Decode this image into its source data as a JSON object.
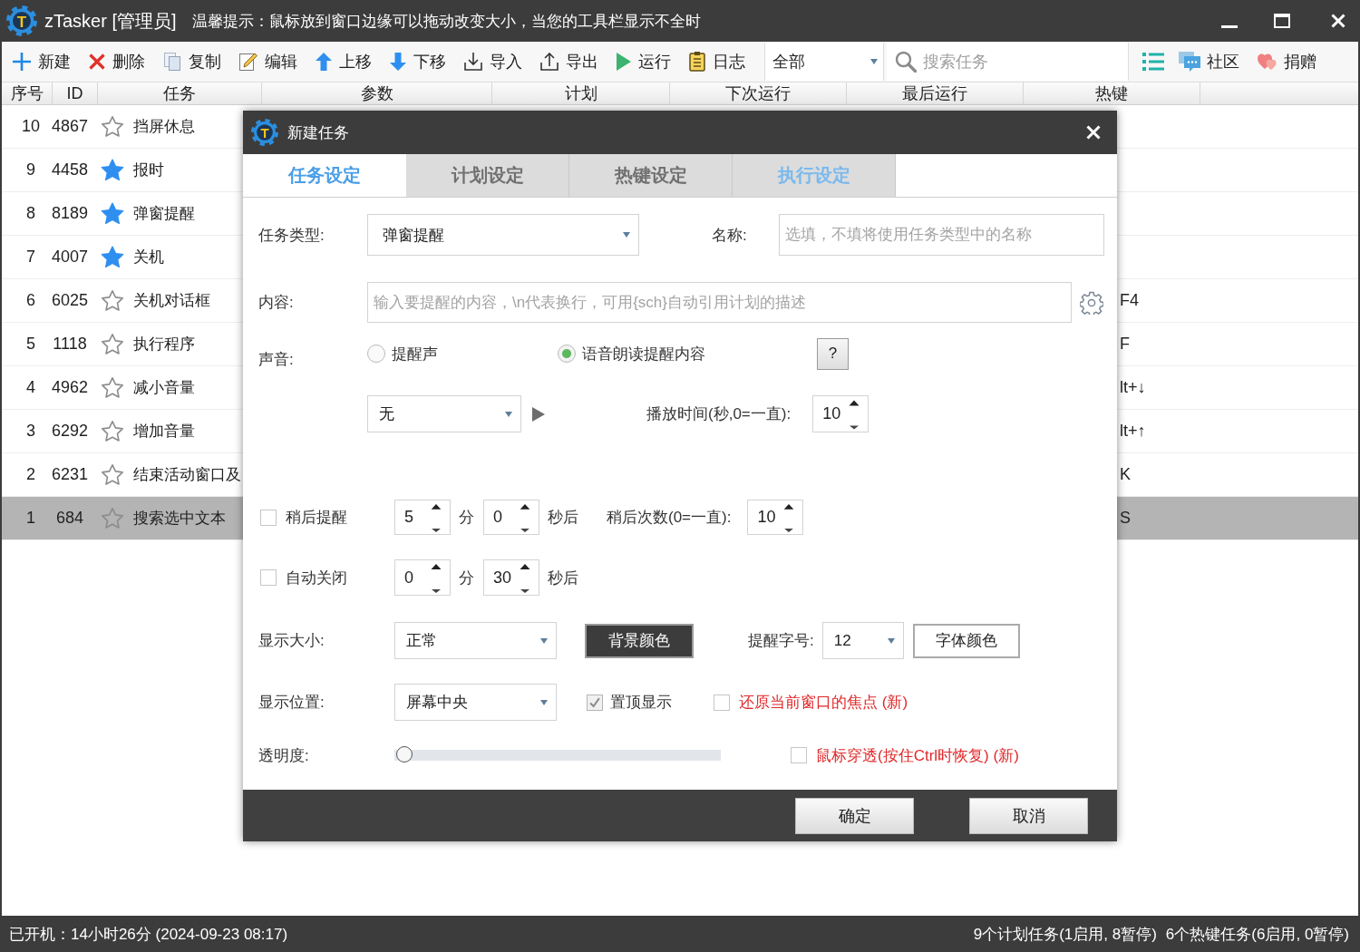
{
  "window": {
    "logo": "T",
    "title": "zTasker [管理员]",
    "tip": "温馨提示：鼠标放到窗口边缘可以拖动改变大小，当您的工具栏显示不全时"
  },
  "toolbar": {
    "buttons": [
      {
        "kind": "new",
        "label": "新建"
      },
      {
        "kind": "delete",
        "label": "删除"
      },
      {
        "kind": "copy",
        "label": "复制"
      },
      {
        "kind": "edit",
        "label": "编辑"
      },
      {
        "kind": "up",
        "label": "上移"
      },
      {
        "kind": "down",
        "label": "下移"
      },
      {
        "kind": "import",
        "label": "导入"
      },
      {
        "kind": "export",
        "label": "导出"
      },
      {
        "kind": "run",
        "label": "运行"
      },
      {
        "kind": "log",
        "label": "日志"
      }
    ],
    "filter": {
      "value": "全部"
    },
    "search": {
      "placeholder": "搜索任务"
    },
    "links": [
      {
        "kind": "community",
        "label": "社区"
      },
      {
        "kind": "donate",
        "label": "捐赠"
      }
    ]
  },
  "table": {
    "columns": [
      "序号",
      "ID",
      "任务",
      "参数",
      "计划",
      "下次运行",
      "最后运行",
      "热键"
    ],
    "rows": [
      {
        "index": "10",
        "id": "4867",
        "task": "挡屏休息",
        "starred": false,
        "selected": false
      },
      {
        "index": "9",
        "id": "4458",
        "task": "报时",
        "starred": true,
        "selected": false
      },
      {
        "index": "8",
        "id": "8189",
        "task": "弹窗提醒",
        "starred": true,
        "selected": false
      },
      {
        "index": "7",
        "id": "4007",
        "task": "关机",
        "starred": true,
        "selected": false
      },
      {
        "index": "6",
        "id": "6025",
        "task": "关机对话框",
        "starred": false,
        "selected": false,
        "hotkey": "F4"
      },
      {
        "index": "5",
        "id": "1118",
        "task": "执行程序",
        "starred": false,
        "selected": false,
        "hotkey": "F"
      },
      {
        "index": "4",
        "id": "4962",
        "task": "减小音量",
        "starred": false,
        "selected": false,
        "hotkey": "lt+↓"
      },
      {
        "index": "3",
        "id": "6292",
        "task": "增加音量",
        "starred": false,
        "selected": false,
        "hotkey": "lt+↑"
      },
      {
        "index": "2",
        "id": "6231",
        "task": "结束活动窗口及",
        "starred": false,
        "selected": false,
        "hotkey": "K"
      },
      {
        "index": "1",
        "id": "684",
        "task": "搜索选中文本",
        "starred": false,
        "selected": true,
        "hotkey": "S"
      }
    ]
  },
  "dialog": {
    "logo": "T",
    "title": "新建任务",
    "tabs": [
      {
        "label": "任务设定",
        "selected": true,
        "highlighted": false
      },
      {
        "label": "计划设定",
        "selected": false,
        "highlighted": false
      },
      {
        "label": "热键设定",
        "selected": false,
        "highlighted": false
      },
      {
        "label": "执行设定",
        "selected": false,
        "highlighted": true
      }
    ],
    "task_type": {
      "label": "任务类型:",
      "value": "弹窗提醒"
    },
    "name": {
      "label": "名称:",
      "placeholder": "选填，不填将使用任务类型中的名称"
    },
    "content": {
      "label": "内容:",
      "placeholder": "输入要提醒的内容，\\n代表换行，可用{sch}自动引用计划的描述"
    },
    "sound": {
      "label": "声音:",
      "options": [
        {
          "label": "提醒声",
          "selected": false
        },
        {
          "label": "语音朗读提醒内容",
          "selected": true
        }
      ],
      "help": "?",
      "file": "无",
      "duration_label": "播放时间(秒,0=一直):",
      "duration": "10"
    },
    "snooze": {
      "label": "稍后提醒",
      "checked": false,
      "minutes": "5",
      "minutes_unit": "分",
      "seconds": "0",
      "seconds_unit": "秒后",
      "count_label": "稍后次数(0=一直):",
      "count": "10"
    },
    "auto_close": {
      "label": "自动关闭",
      "checked": false,
      "minutes": "0",
      "minutes_unit": "分",
      "seconds": "30",
      "seconds_unit": "秒后"
    },
    "size": {
      "label": "显示大小:",
      "value": "正常",
      "background_button": "背景颜色",
      "font_size_label": "提醒字号:",
      "font_size": "12",
      "font_color_button": "字体颜色"
    },
    "position": {
      "label": "显示位置:",
      "value": "屏幕中央",
      "options": [
        {
          "label": "置顶显示",
          "checked": true,
          "emphasized": false
        },
        {
          "label": "还原当前窗口的焦点 (新)",
          "checked": false,
          "emphasized": true
        }
      ]
    },
    "opacity": {
      "label": "透明度:",
      "level": 0,
      "option": {
        "label": "鼠标穿透(按住Ctrl时恢复) (新)",
        "checked": false,
        "emphasized": true
      }
    },
    "buttons": [
      "确定",
      "取消"
    ]
  },
  "status_bar": {
    "uptime": "已开机：14小时26分 (2024-09-23 08:17)",
    "summary": [
      "9个计划任务(1启用, 8暂停)",
      "6个热键任务(6启用, 0暂停)"
    ]
  }
}
